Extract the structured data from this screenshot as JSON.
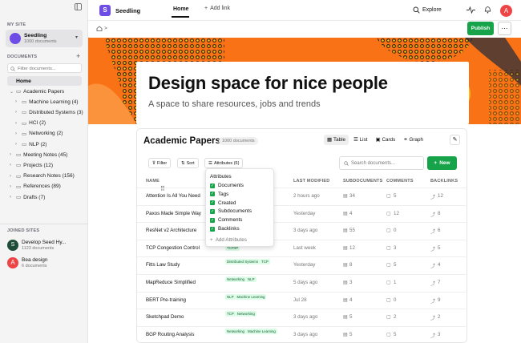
{
  "sidebar": {
    "my_site_label": "MY SITE",
    "site_name": "Seedling",
    "site_docs": "1000 documents",
    "documents_label": "DOCUMENTS",
    "filter_placeholder": "Filter documents...",
    "home": "Home",
    "tree": [
      {
        "label": "Academic Papers",
        "level": 0,
        "open": true
      },
      {
        "label": "Machine Learning (4)",
        "level": 1
      },
      {
        "label": "Distributed Systems (3)",
        "level": 1
      },
      {
        "label": "HCI (2)",
        "level": 1
      },
      {
        "label": "Networking (2)",
        "level": 1
      },
      {
        "label": "NLP (2)",
        "level": 1
      },
      {
        "label": "Meeting Notes (45)",
        "level": 0
      },
      {
        "label": "Projects (12)",
        "level": 0
      },
      {
        "label": "Research Notes (156)",
        "level": 0
      },
      {
        "label": "References (89)",
        "level": 0
      },
      {
        "label": "Drafts (7)",
        "level": 0
      }
    ],
    "joined_label": "JOINED SITES",
    "joined": [
      {
        "name": "Develop Seed Hy...",
        "docs": "1123 documents",
        "color": "#1f4d3a"
      },
      {
        "name": "Bea design",
        "docs": "6 documents",
        "color": "#ef4444"
      }
    ]
  },
  "topbar": {
    "logo_letter": "S",
    "app_name": "Seedling",
    "home_tab": "Home",
    "add_link": "Add link",
    "explore": "Explore",
    "avatar_letter": "A",
    "breadcrumb": ">",
    "publish": "Publish",
    "more": "⋯"
  },
  "hero": {
    "title": "Design space for nice people",
    "subtitle": "A space to share resources, jobs and trends"
  },
  "panel": {
    "title": "Academic Papers",
    "count_badge": "1000 documents",
    "views": [
      "Table",
      "List",
      "Cards",
      "Graph"
    ],
    "filter": "Filter",
    "sort": "Sort",
    "attributes_btn": "Attributes (6)",
    "search_placeholder": "Search documents...",
    "new_btn": "New",
    "columns": [
      "NAME",
      "LAST MODIFIED",
      "SUBDOCUMENTS",
      "COMMENTS",
      "BACKLINKS"
    ],
    "rows": [
      {
        "name": "Attention Is All You Need",
        "tags": [],
        "modified": "2 hours ago",
        "subdocs": "34",
        "comments": "5",
        "backlinks": "12"
      },
      {
        "name": "Paxos Made Simple Way",
        "tags": [],
        "modified": "Yesterday",
        "subdocs": "4",
        "comments": "12",
        "backlinks": "8"
      },
      {
        "name": "ResNet v2 Architecture",
        "tags": [],
        "modified": "3 days ago",
        "subdocs": "55",
        "comments": "0",
        "backlinks": "6"
      },
      {
        "name": "TCP Congestion Control",
        "tags": [
          "TCP/IP"
        ],
        "modified": "Last week",
        "subdocs": "12",
        "comments": "3",
        "backlinks": "5"
      },
      {
        "name": "Fitts Law Study",
        "tags": [
          "Distributed Systems",
          "TCP"
        ],
        "modified": "Yesterday",
        "subdocs": "8",
        "comments": "5",
        "backlinks": "4"
      },
      {
        "name": "MapReduce Simplified",
        "tags": [
          "Networking",
          "NLP"
        ],
        "modified": "5 days ago",
        "subdocs": "3",
        "comments": "1",
        "backlinks": "7"
      },
      {
        "name": "BERT Pre-training",
        "tags": [
          "NLP",
          "Machine Learning"
        ],
        "modified": "Jul 28",
        "subdocs": "4",
        "comments": "0",
        "backlinks": "9"
      },
      {
        "name": "Sketchpad Demo",
        "tags": [
          "TCP",
          "Networking"
        ],
        "modified": "3 days ago",
        "subdocs": "5",
        "comments": "2",
        "backlinks": "2"
      },
      {
        "name": "BGP Routing Analysis",
        "tags": [
          "Networking",
          "Machine Learning"
        ],
        "modified": "3 days ago",
        "subdocs": "5",
        "comments": "5",
        "backlinks": "3"
      }
    ]
  },
  "attributes_menu": {
    "heading": "Attributes",
    "items": [
      "Documents",
      "Tags",
      "Created",
      "Subdocuments",
      "Comments",
      "Backlinks"
    ],
    "add": "Add Attributes"
  },
  "colors": {
    "accent": "#16a34a",
    "brand": "#6d4de6",
    "hero_orange": "#f97316"
  }
}
